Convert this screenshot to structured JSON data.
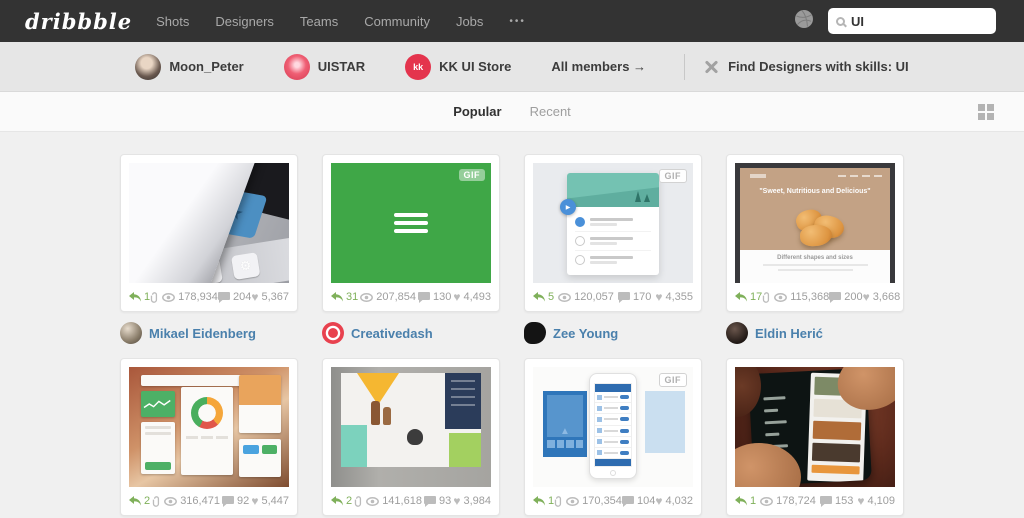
{
  "nav": {
    "logo": "dribbble",
    "items": [
      "Shots",
      "Designers",
      "Teams",
      "Community",
      "Jobs"
    ],
    "more_label": "•••",
    "search": {
      "value": "UI"
    }
  },
  "members_bar": {
    "members": [
      {
        "name": "Moon_Peter",
        "avatar": "photo"
      },
      {
        "name": "UISTAR",
        "avatar": "flower"
      },
      {
        "name": "KK UI Store",
        "avatar": "kk-badge",
        "avatar_text": "kk"
      }
    ],
    "all_members_label": "All members →",
    "find_designers_label": "Find Designers with skills: UI"
  },
  "tabs": {
    "items": [
      {
        "label": "Popular",
        "active": true
      },
      {
        "label": "Recent",
        "active": false
      }
    ]
  },
  "shots_labels": {
    "gif": "GIF"
  },
  "colors": {
    "navbar_bg": "#333333",
    "rebound_green": "#7fb05a",
    "author_link_blue": "#4a80ac",
    "gif_card_green": "#3fa747",
    "accent_red": "#e4344d"
  },
  "shots": [
    {
      "rebounds": "1",
      "views": "178,934",
      "comments": "204",
      "likes": "5,367",
      "attachment": true,
      "gif": null,
      "art": "sticker-peel",
      "desc": "Photo of peeling sticker revealing blue star key",
      "author": {
        "name": "Mikael Eidenberg",
        "avatar": "mikael"
      }
    },
    {
      "rebounds": "31",
      "views": "207,854",
      "comments": "130",
      "likes": "4,493",
      "attachment": false,
      "gif": "solid",
      "art": "green-menu",
      "desc": "Green animated hamburger menu GIF",
      "author": {
        "name": "Creativedash",
        "avatar": "creativedash"
      }
    },
    {
      "rebounds": "5",
      "views": "120,057",
      "comments": "170",
      "likes": "4,355",
      "attachment": false,
      "gif": "outline",
      "art": "material-card",
      "desc": "Material design list card with landscape header GIF",
      "author": {
        "name": "Zee Young",
        "avatar": "zee"
      }
    },
    {
      "rebounds": "17",
      "views": "115,368",
      "comments": "200",
      "likes": "3,668",
      "attachment": true,
      "gif": null,
      "art": "pastry-site",
      "desc": "Food website with pastries",
      "headline": "\"Sweet, Nutritious and Delicious\"",
      "subheadline": "Different shapes and sizes",
      "author": {
        "name": "Eldin Herić",
        "avatar": "eldin"
      }
    },
    {
      "rebounds": "2",
      "views": "316,471",
      "comments": "92",
      "likes": "5,447",
      "attachment": true,
      "gif": null,
      "art": "ui-kit",
      "desc": "Flat UI kit with donut chart on brown background",
      "author": null
    },
    {
      "rebounds": "2",
      "views": "141,618",
      "comments": "93",
      "likes": "3,984",
      "attachment": true,
      "gif": null,
      "art": "shop-grid",
      "desc": "E-commerce grid website with product tiles",
      "author": null
    },
    {
      "rebounds": "1",
      "views": "170,354",
      "comments": "104",
      "likes": "4,032",
      "attachment": true,
      "gif": "outline",
      "art": "wireframe-phone",
      "desc": "iPhone app wireframe screens GIF",
      "author": null
    },
    {
      "rebounds": "1",
      "views": "178,724",
      "comments": "153",
      "likes": "4,109",
      "attachment": false,
      "gif": null,
      "art": "phone-photo",
      "desc": "Hands holding phone with app side menu",
      "author": null
    }
  ]
}
